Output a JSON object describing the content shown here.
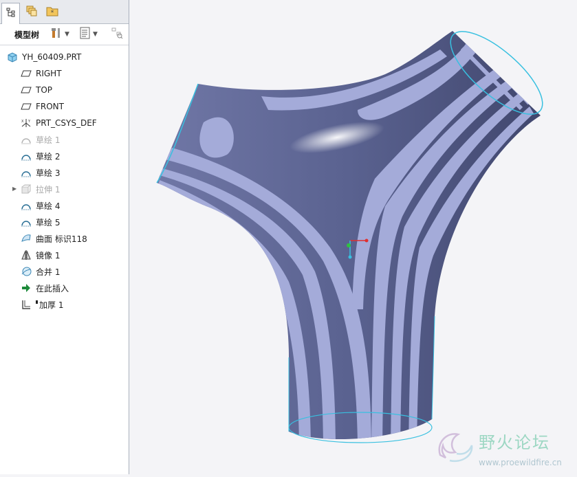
{
  "model_tree": {
    "title": "模型树",
    "tabs": [
      {
        "icon": "model-tree-tab-icon",
        "active": true
      },
      {
        "icon": "layers-tab-icon",
        "active": false
      },
      {
        "icon": "favorites-folder-tab-icon",
        "active": false
      }
    ],
    "root": "YH_60409.PRT",
    "items": [
      {
        "label": "RIGHT",
        "icon": "datum-plane-icon",
        "dim": false
      },
      {
        "label": "TOP",
        "icon": "datum-plane-icon",
        "dim": false
      },
      {
        "label": "FRONT",
        "icon": "datum-plane-icon",
        "dim": false
      },
      {
        "label": "PRT_CSYS_DEF",
        "icon": "coordinate-system-icon",
        "dim": false
      },
      {
        "label": "草绘 1",
        "icon": "sketch-icon",
        "dim": true
      },
      {
        "label": "草绘 2",
        "icon": "sketch-icon",
        "dim": false
      },
      {
        "label": "草绘 3",
        "icon": "sketch-icon",
        "dim": false
      },
      {
        "label": "拉伸 1",
        "icon": "extrude-icon",
        "dim": true
      },
      {
        "label": "草绘 4",
        "icon": "sketch-icon",
        "dim": false
      },
      {
        "label": "草绘 5",
        "icon": "sketch-icon",
        "dim": false
      },
      {
        "label": "曲面 标识118",
        "icon": "surface-icon",
        "dim": false
      },
      {
        "label": "镜像 1",
        "icon": "mirror-icon",
        "dim": false
      },
      {
        "label": "合并 1",
        "icon": "merge-icon",
        "dim": false
      },
      {
        "label": "在此插入",
        "icon": "insert-here-arrow-icon",
        "dim": false
      },
      {
        "label": "加厚 1",
        "icon": "thicken-icon",
        "dim": false
      }
    ]
  },
  "watermark": {
    "title": "野火论坛",
    "url": "www.proewildfire.cn"
  },
  "colors": {
    "surface_dark": "#5a6290",
    "surface_light": "#a4abd9",
    "edge": "#38c0e0",
    "panel_border": "#a9b0bd"
  }
}
